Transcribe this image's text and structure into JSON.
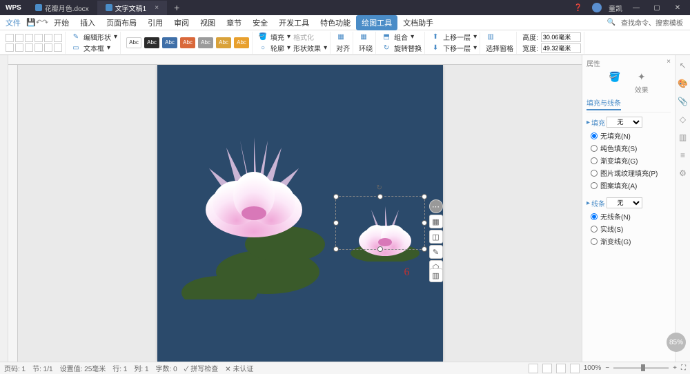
{
  "titlebar": {
    "app": "WPS",
    "tabs": [
      {
        "icon": true,
        "label": "花瓣月色.docx",
        "active": false
      },
      {
        "icon": true,
        "label": "文字文稿1",
        "active": true
      }
    ],
    "username": "童凯"
  },
  "menubar": {
    "file": "文件",
    "items": [
      "开始",
      "插入",
      "页面布局",
      "引用",
      "审阅",
      "视图",
      "章节",
      "安全",
      "开发工具",
      "特色功能",
      "绘图工具",
      "文档助手"
    ],
    "active_index": 10,
    "search_hint": "查找命令、搜索模板"
  },
  "ribbon": {
    "edit_shape": "编辑形状",
    "text_box": "文本框",
    "styles": [
      {
        "label": "Abc",
        "bg": "#ffffff",
        "color": "#333"
      },
      {
        "label": "Abc",
        "bg": "#2b2b2b"
      },
      {
        "label": "Abc",
        "bg": "#3f6fa8"
      },
      {
        "label": "Abc",
        "bg": "#d9683a"
      },
      {
        "label": "Abc",
        "bg": "#9b9b9b"
      },
      {
        "label": "Abc",
        "bg": "#d9a23a"
      },
      {
        "label": "Abc",
        "bg": "#e8a02e"
      }
    ],
    "fill": "填充",
    "outline": "轮廓",
    "format_brush": "格式化",
    "shape_effect": "形状效果",
    "align": "对齐",
    "wrap": "环绕",
    "rotate": "旋转替换",
    "combine": "组合",
    "move_up": "上移一层",
    "move_down": "下移一层",
    "sel_pane": "选择窗格",
    "height_label": "高度:",
    "height_value": "30.06毫米",
    "width_label": "宽度:",
    "width_value": "49.32毫米"
  },
  "canvas": {
    "page_number": "6"
  },
  "rightpanel": {
    "title": "属性",
    "tab_fill": "填充与线条",
    "tab_effect": "效果",
    "fill_section": "填充",
    "fill_select": "无",
    "fill_options": [
      "无填充(N)",
      "纯色填充(S)",
      "渐变填充(G)",
      "图片或纹理填充(P)",
      "图案填充(A)"
    ],
    "fill_selected": 0,
    "line_section": "线条",
    "line_select": "无",
    "line_options": [
      "无线条(N)",
      "实线(S)",
      "渐变线(G)"
    ],
    "line_selected": 0
  },
  "percent_badge": "85%",
  "statusbar": {
    "page": "页码: 1",
    "pages": "节: 1/1",
    "pos": "设置值: 25毫米",
    "line": "行: 1",
    "col": "列: 1",
    "chars": "字数: 0",
    "spell": "拼写检查",
    "confirm": "未认证",
    "zoom": "100%"
  }
}
